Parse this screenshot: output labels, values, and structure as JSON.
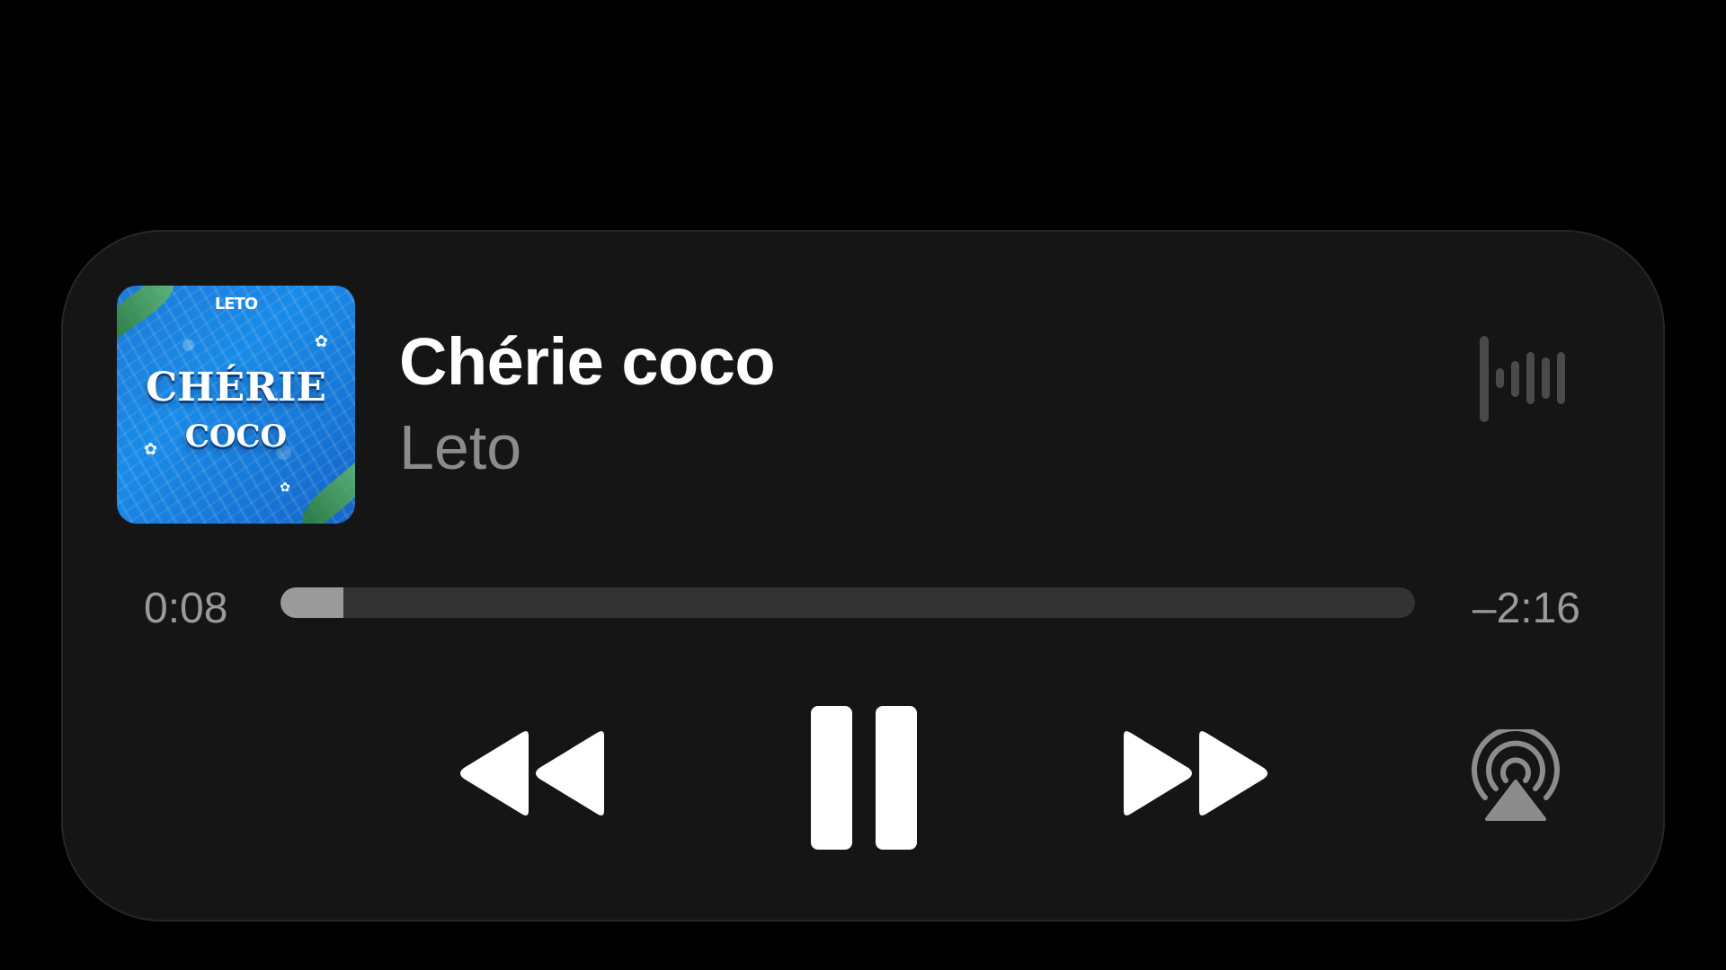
{
  "now_playing": {
    "artwork": {
      "brand": "LETO",
      "title_line1": "CHÉRIE",
      "title_line2": "COCO"
    },
    "title": "Chérie coco",
    "artist": "Leto"
  },
  "progress": {
    "elapsed": "0:08",
    "remaining": "–2:16",
    "fraction": 0.0556
  },
  "controls": {
    "rewind": "backward-icon",
    "pause": "pause-icon",
    "forward": "forward-icon",
    "airplay": "airplay-audio-icon",
    "waveform": "waveform-icon"
  },
  "colors": {
    "background": "#000000",
    "card": "#151515",
    "primary_text": "#ffffff",
    "secondary_text": "#8c8c8c",
    "progress_track": "#333333",
    "progress_fill": "#9a9a9a"
  }
}
